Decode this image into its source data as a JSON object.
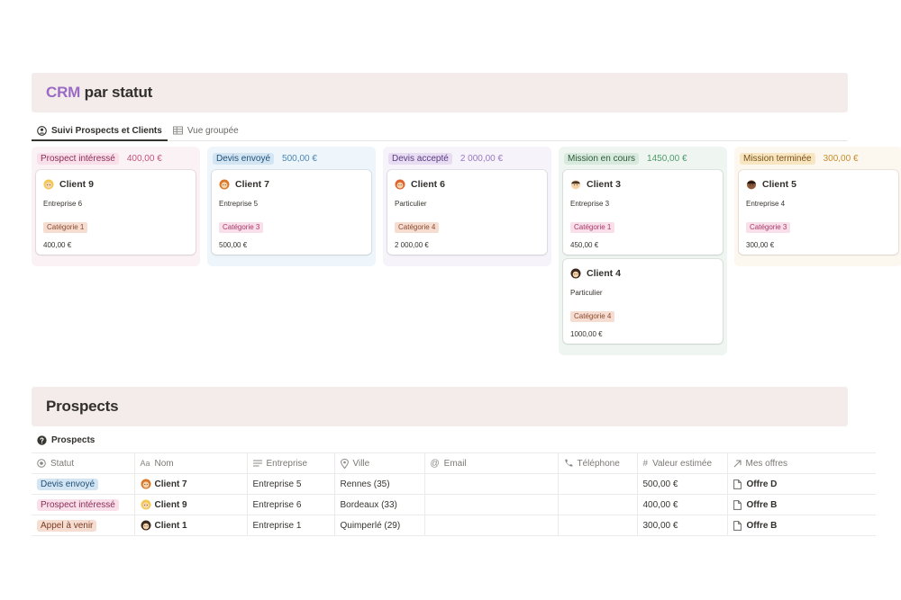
{
  "board_banner": {
    "accent": "CRM",
    "rest": "par statut"
  },
  "tabs": [
    {
      "label": "Suivi Prospects et Clients",
      "icon": "user-circle-icon"
    },
    {
      "label": "Vue groupée",
      "icon": "table-icon"
    }
  ],
  "columns": [
    {
      "status": "Prospect intéressé",
      "sum": "400,00 €",
      "colors": {
        "bg": "#fbf2f5",
        "pill": "#f9dfe9",
        "pill_text": "#8b2e58",
        "sum": "#c4557f"
      },
      "cards": [
        {
          "name": "Client 9",
          "avatar": "avatar-blond-icon",
          "company": "Entreprise 6",
          "category": "Catégorie 1",
          "value": "400,00 €"
        }
      ]
    },
    {
      "status": "Devis envoyé",
      "sum": "500,00 €",
      "colors": {
        "bg": "#eef6fb",
        "pill": "#d3e5f3",
        "pill_text": "#1f4f78",
        "sum": "#4a87b5"
      },
      "cards": [
        {
          "name": "Client 7",
          "avatar": "avatar-woman-orange-icon",
          "company": "Entreprise 5",
          "category": "Catégorie 3",
          "value": "500,00 €"
        }
      ]
    },
    {
      "status": "Devis accepté",
      "sum": "2 000,00 €",
      "colors": {
        "bg": "#f7f3fb",
        "pill": "#e7dcf2",
        "pill_text": "#5b3a80",
        "sum": "#9a79bf"
      },
      "cards": [
        {
          "name": "Client 6",
          "avatar": "avatar-redhead-icon",
          "company": "Particulier",
          "category": "Catégorie 4",
          "value": "2 000,00 €"
        }
      ]
    },
    {
      "status": "Mission en cours",
      "sum": "1450,00 €",
      "colors": {
        "bg": "#eff6f1",
        "pill": "#d8eadd",
        "pill_text": "#2b593a",
        "sum": "#4f9a68"
      },
      "cards": [
        {
          "name": "Client 3",
          "avatar": "avatar-man-icon",
          "company": "Entreprise 3",
          "category": "Catégorie 1",
          "value": "450,00 €"
        },
        {
          "name": "Client 4",
          "avatar": "avatar-woman-dark-icon",
          "company": "Particulier",
          "category": "Catégorie 4",
          "value": "1000,00 €"
        }
      ]
    },
    {
      "status": "Mission terminée",
      "sum": "300,00 €",
      "colors": {
        "bg": "#fdf8ef",
        "pill": "#f8e5c2",
        "pill_text": "#7a5214",
        "sum": "#c98d2e"
      },
      "cards": [
        {
          "name": "Client 5",
          "avatar": "avatar-man-dark-icon",
          "company": "Entreprise 4",
          "category": "Catégorie 3",
          "value": "300,00 €"
        }
      ]
    }
  ],
  "prospects_banner": {
    "title": "Prospects"
  },
  "prospects_view": {
    "label": "Prospects",
    "icon": "question-circle-icon"
  },
  "table": {
    "headers": [
      {
        "label": "Statut",
        "icon": "status-icon"
      },
      {
        "label": "Nom",
        "icon": "text-aa-icon"
      },
      {
        "label": "Entreprise",
        "icon": "lines-icon"
      },
      {
        "label": "Ville",
        "icon": "pin-icon"
      },
      {
        "label": "Email",
        "icon": "at-icon"
      },
      {
        "label": "Téléphone",
        "icon": "phone-icon"
      },
      {
        "label": "Valeur estimée",
        "icon": "hash-icon"
      },
      {
        "label": "Mes offres",
        "icon": "relation-arrow-icon"
      }
    ],
    "rows": [
      {
        "status": "Devis envoyé",
        "status_bg": "#d3e5f3",
        "status_color": "#1f4f78",
        "name": "Client 7",
        "avatar": "avatar-woman-orange-icon",
        "company": "Entreprise 5",
        "city": "Rennes (35)",
        "email": "",
        "phone": "",
        "value": "500,00 €",
        "offer": "Offre D"
      },
      {
        "status": "Prospect intéressé",
        "status_bg": "#f9dfe9",
        "status_color": "#8b2e58",
        "name": "Client 9",
        "avatar": "avatar-blond-icon",
        "company": "Entreprise 6",
        "city": "Bordeaux (33)",
        "email": "",
        "phone": "",
        "value": "400,00 €",
        "offer": "Offre B"
      },
      {
        "status": "Appel à venir",
        "status_bg": "#f5ddd2",
        "status_color": "#7c3d22",
        "name": "Client 1",
        "avatar": "avatar-woman-dark-icon",
        "company": "Entreprise 1",
        "city": "Quimperlé (29)",
        "email": "",
        "phone": "",
        "value": "300,00 €",
        "offer": "Offre B"
      }
    ]
  }
}
